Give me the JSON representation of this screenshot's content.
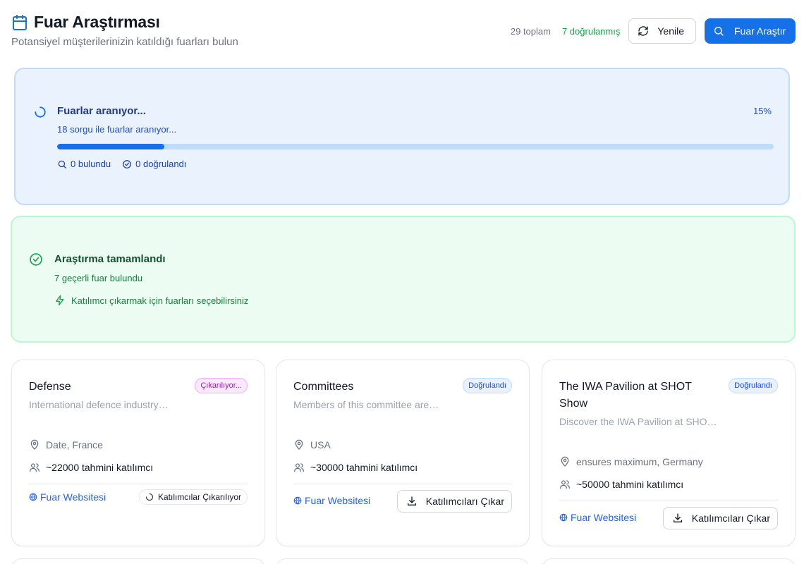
{
  "header": {
    "title": "Fuar Araştırması",
    "subtitle": "Potansiyel müşterilerinizin katıldığı fuarları bulun",
    "total": "29 toplam",
    "verified": "7 doğrulanmış",
    "refresh_label": "Yenile",
    "search_label": "Fuar Araştır",
    "icons": {
      "title": "calendar-icon",
      "refresh": "refresh-icon",
      "search": "search-icon"
    }
  },
  "progress": {
    "title": "Fuarlar aranıyor...",
    "subtitle": "18 sorgu ile fuarlar aranıyor...",
    "percent_label": "15%",
    "percent": 15,
    "found": "0 bulundu",
    "verified": "0 doğrulandı"
  },
  "done": {
    "title": "Araştırma tamamlandı",
    "subtitle": "7 geçerli fuar bulundu",
    "hint": "Katılımcı çıkarmak için fuarları seçebilirsiniz"
  },
  "cards": [
    {
      "title": "Defense",
      "badge": "Çıkarılıyor...",
      "description": "International defence industry…",
      "location": "Date, France",
      "attendees": "~22000 tahmini katılımcı",
      "website": "Fuar Websitesi",
      "action": "Katılımcılar Çıkarılıyor"
    },
    {
      "title": "Committees",
      "badge": "Doğrulandı",
      "description": "Members of this committee are…",
      "location": "USA",
      "attendees": "~30000 tahmini katılımcı",
      "website": "Fuar Websitesi",
      "action": "Katılımcıları Çıkar"
    },
    {
      "title": "The IWA Pavilion at SHOT Show",
      "badge": "Doğrulandı",
      "description": "Discover the IWA Pavilion at SHO…",
      "location": "ensures maximum, Germany",
      "attendees": "~50000 tahmini katılımcı",
      "website": "Fuar Websitesi",
      "action": "Katılımcıları Çıkar"
    }
  ],
  "colors": {
    "primary": "#1670e8",
    "progress_bg": "#eaf2fd",
    "success_bg": "#edfcf2",
    "success_text": "#15803d",
    "badge_extract": "#a21caf"
  }
}
